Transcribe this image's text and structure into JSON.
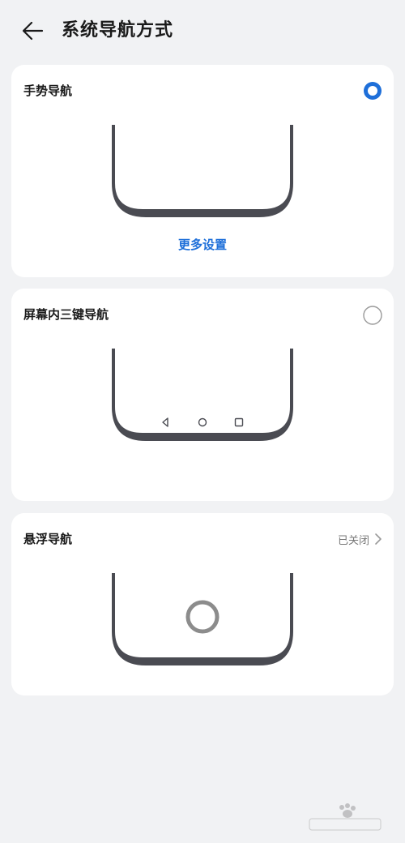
{
  "header": {
    "title": "系统导航方式",
    "back_icon": "arrow-left-icon"
  },
  "gesture": {
    "title": "手势导航",
    "selected": true,
    "more_label": "更多设置"
  },
  "three_key": {
    "title": "屏幕内三键导航",
    "selected": false
  },
  "floating": {
    "title": "悬浮导航",
    "status": "已关闭"
  },
  "colors": {
    "accent": "#1e6fd9",
    "background": "#f1f2f4",
    "card": "#ffffff",
    "phone_outline": "#4a4b52"
  }
}
